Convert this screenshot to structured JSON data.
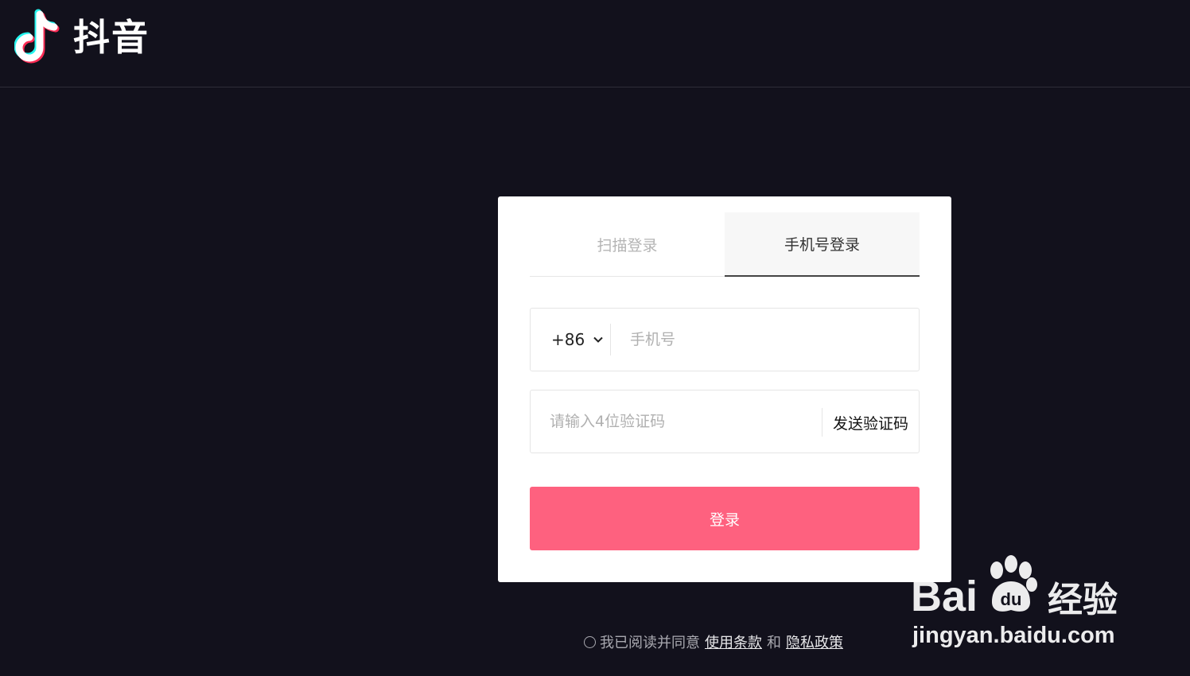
{
  "header": {
    "app_name": "抖音"
  },
  "login": {
    "tabs": [
      {
        "label": "扫描登录",
        "active": false
      },
      {
        "label": "手机号登录",
        "active": true
      }
    ],
    "country_code": "+86",
    "phone_placeholder": "手机号",
    "code_placeholder": "请输入4位验证码",
    "send_code_label": "发送验证码",
    "submit_label": "登录"
  },
  "agreement": {
    "prefix": "我已阅读并同意",
    "terms_link": "使用条款",
    "conjunction": "和",
    "privacy_link": "隐私政策"
  },
  "watermark": {
    "brand": "Bai",
    "brand_suffix": "经验",
    "url": "jingyan.baidu.com"
  },
  "colors": {
    "background": "#12111c",
    "accent": "#fe617f"
  },
  "icons": {
    "logo": "douyin-note-icon",
    "country_dropdown": "chevron-down-icon",
    "watermark": "baidu-paw-icon"
  }
}
